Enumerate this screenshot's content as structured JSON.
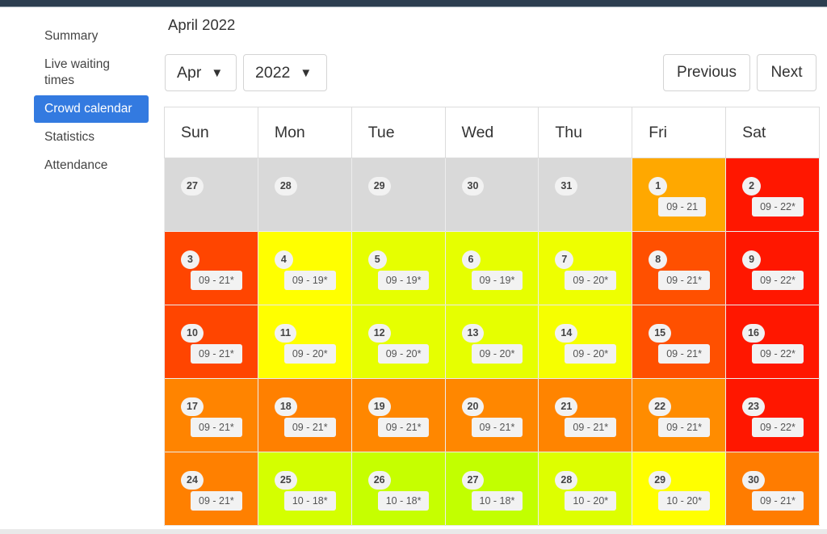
{
  "sidebar": {
    "items": [
      {
        "label": "Summary",
        "active": false
      },
      {
        "label": "Live waiting times",
        "active": false
      },
      {
        "label": "Crowd calendar",
        "active": true
      },
      {
        "label": "Statistics",
        "active": false
      },
      {
        "label": "Attendance",
        "active": false
      }
    ]
  },
  "header": {
    "title": "April 2022",
    "month_select": {
      "value": "Apr",
      "caret": "▼"
    },
    "year_select": {
      "value": "2022",
      "caret": "▼"
    },
    "previous_label": "Previous",
    "next_label": "Next"
  },
  "calendar": {
    "weekdays": [
      "Sun",
      "Mon",
      "Tue",
      "Wed",
      "Thu",
      "Fri",
      "Sat"
    ],
    "weeks": [
      [
        {
          "day": "27",
          "hours": "",
          "color": "#d9d9d9",
          "in_month": false
        },
        {
          "day": "28",
          "hours": "",
          "color": "#d9d9d9",
          "in_month": false
        },
        {
          "day": "29",
          "hours": "",
          "color": "#d9d9d9",
          "in_month": false
        },
        {
          "day": "30",
          "hours": "",
          "color": "#d9d9d9",
          "in_month": false
        },
        {
          "day": "31",
          "hours": "",
          "color": "#d9d9d9",
          "in_month": false
        },
        {
          "day": "1",
          "hours": "09 - 21",
          "color": "#ffa800",
          "in_month": true
        },
        {
          "day": "2",
          "hours": "09 - 22*",
          "color": "#ff1700",
          "in_month": true
        }
      ],
      [
        {
          "day": "3",
          "hours": "09 - 21*",
          "color": "#ff4500",
          "in_month": true
        },
        {
          "day": "4",
          "hours": "09 - 19*",
          "color": "#ffff00",
          "in_month": true
        },
        {
          "day": "5",
          "hours": "09 - 19*",
          "color": "#e6ff00",
          "in_month": true
        },
        {
          "day": "6",
          "hours": "09 - 19*",
          "color": "#e6ff00",
          "in_month": true
        },
        {
          "day": "7",
          "hours": "09 - 20*",
          "color": "#eeff00",
          "in_month": true
        },
        {
          "day": "8",
          "hours": "09 - 21*",
          "color": "#ff5000",
          "in_month": true
        },
        {
          "day": "9",
          "hours": "09 - 22*",
          "color": "#ff1700",
          "in_month": true
        }
      ],
      [
        {
          "day": "10",
          "hours": "09 - 21*",
          "color": "#ff4500",
          "in_month": true
        },
        {
          "day": "11",
          "hours": "09 - 20*",
          "color": "#ffff00",
          "in_month": true
        },
        {
          "day": "12",
          "hours": "09 - 20*",
          "color": "#e6ff00",
          "in_month": true
        },
        {
          "day": "13",
          "hours": "09 - 20*",
          "color": "#e6ff00",
          "in_month": true
        },
        {
          "day": "14",
          "hours": "09 - 20*",
          "color": "#f6ff00",
          "in_month": true
        },
        {
          "day": "15",
          "hours": "09 - 21*",
          "color": "#ff5000",
          "in_month": true
        },
        {
          "day": "16",
          "hours": "09 - 22*",
          "color": "#ff1700",
          "in_month": true
        }
      ],
      [
        {
          "day": "17",
          "hours": "09 - 21*",
          "color": "#ff8400",
          "in_month": true
        },
        {
          "day": "18",
          "hours": "09 - 21*",
          "color": "#ff8000",
          "in_month": true
        },
        {
          "day": "19",
          "hours": "09 - 21*",
          "color": "#ff8700",
          "in_month": true
        },
        {
          "day": "20",
          "hours": "09 - 21*",
          "color": "#ff8700",
          "in_month": true
        },
        {
          "day": "21",
          "hours": "09 - 21*",
          "color": "#ff8400",
          "in_month": true
        },
        {
          "day": "22",
          "hours": "09 - 21*",
          "color": "#ff8c00",
          "in_month": true
        },
        {
          "day": "23",
          "hours": "09 - 22*",
          "color": "#ff1700",
          "in_month": true
        }
      ],
      [
        {
          "day": "24",
          "hours": "09 - 21*",
          "color": "#ff8000",
          "in_month": true
        },
        {
          "day": "25",
          "hours": "10 - 18*",
          "color": "#d4ff00",
          "in_month": true
        },
        {
          "day": "26",
          "hours": "10 - 18*",
          "color": "#c6ff00",
          "in_month": true
        },
        {
          "day": "27",
          "hours": "10 - 18*",
          "color": "#c2ff00",
          "in_month": true
        },
        {
          "day": "28",
          "hours": "10 - 20*",
          "color": "#ddff00",
          "in_month": true
        },
        {
          "day": "29",
          "hours": "10 - 20*",
          "color": "#ffff00",
          "in_month": true
        },
        {
          "day": "30",
          "hours": "09 - 21*",
          "color": "#ff7c00",
          "in_month": true
        }
      ]
    ]
  }
}
